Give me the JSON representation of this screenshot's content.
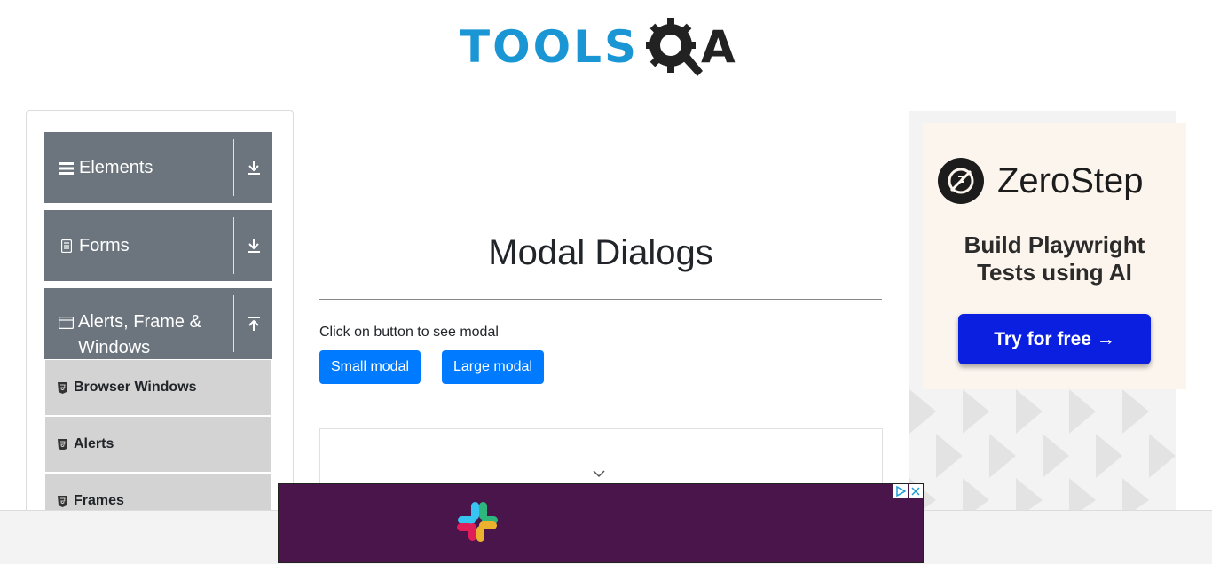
{
  "header": {
    "logo_text_blue": "TOOLS",
    "logo_text_dark": "A"
  },
  "sidebar": {
    "groups": [
      {
        "label": "Elements",
        "icon": "hamburger-icon",
        "arrow": "download-icon"
      },
      {
        "label": "Forms",
        "icon": "document-icon",
        "arrow": "download-icon"
      },
      {
        "label": "Alerts, Frame & Windows",
        "icon": "window-icon",
        "arrow": "upload-icon"
      }
    ],
    "items": [
      {
        "label": "Browser Windows",
        "icon": "html5-icon"
      },
      {
        "label": "Alerts",
        "icon": "html5-icon"
      },
      {
        "label": "Frames",
        "icon": "html5-icon"
      }
    ]
  },
  "main": {
    "title": "Modal Dialogs",
    "instruction": "Click on button to see modal",
    "small_modal_label": "Small modal",
    "large_modal_label": "Large modal"
  },
  "right_ad": {
    "brand": "ZeroStep",
    "tagline": "Build Playwright Tests using AI",
    "cta": "Try for free →"
  },
  "colors": {
    "sidebar_header": "#6c757d",
    "sidebar_item": "#d3d3d3",
    "button": "#007bff",
    "logo_blue": "#1b96d5",
    "ad_cta": "#0a1fe0",
    "bottom_ad_bg": "#4a154b"
  }
}
